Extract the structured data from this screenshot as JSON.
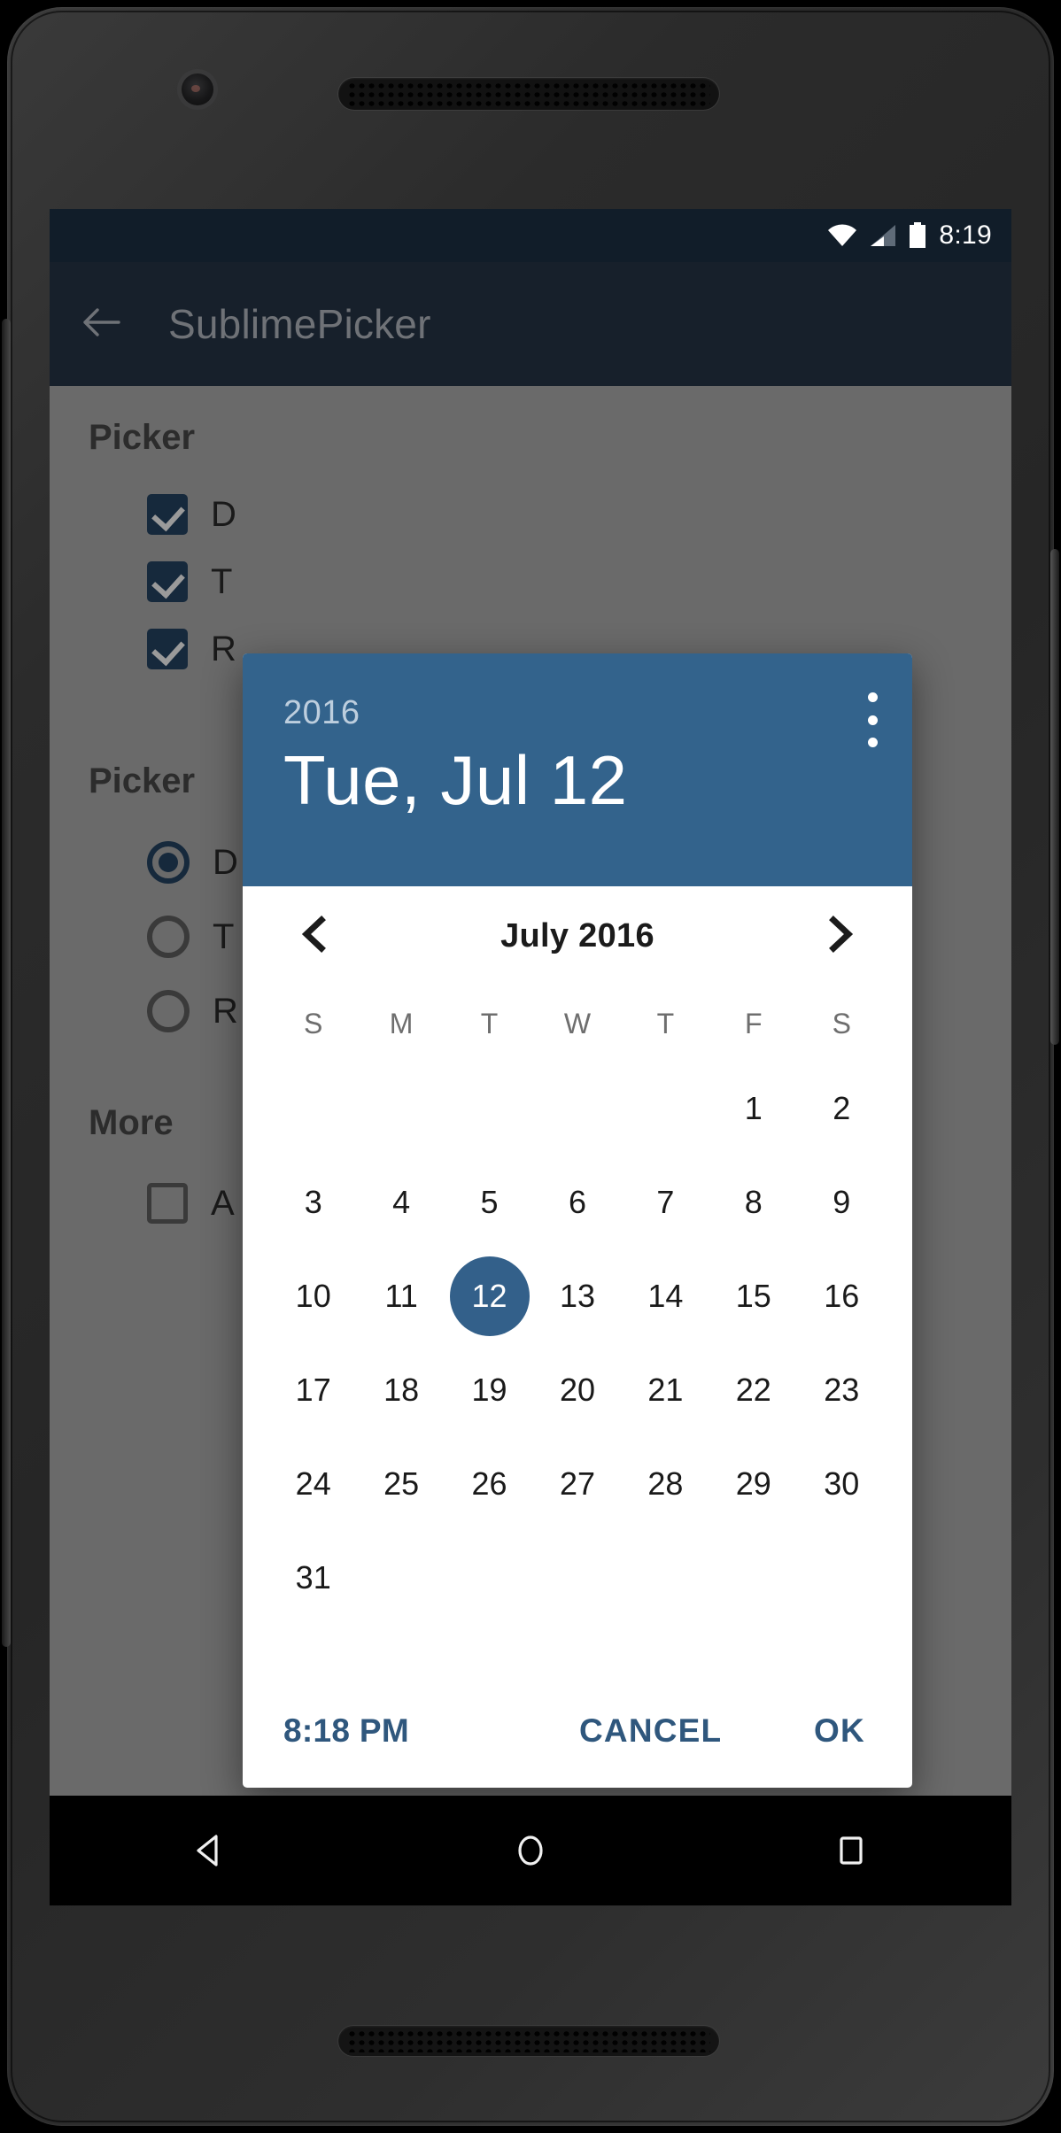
{
  "status_bar": {
    "time": "8:19",
    "icons": [
      "wifi-icon",
      "signal-icon",
      "battery-icon"
    ]
  },
  "app_bar": {
    "back_icon": "back-arrow-icon",
    "title": "SublimePicker"
  },
  "background": {
    "sections": [
      {
        "heading": "Picker",
        "type": "checkbox",
        "options": [
          {
            "label": "D",
            "checked": true
          },
          {
            "label": "T",
            "checked": true
          },
          {
            "label": "R",
            "checked": true
          }
        ]
      },
      {
        "heading": "Picker",
        "type": "radio",
        "options": [
          {
            "label": "D",
            "selected": true
          },
          {
            "label": "T",
            "selected": false
          },
          {
            "label": "R",
            "selected": false
          }
        ]
      },
      {
        "heading": "More",
        "type": "checkbox",
        "options": [
          {
            "label": "A",
            "checked": false
          }
        ]
      }
    ],
    "fab_icon": "rocket-icon"
  },
  "dialog": {
    "header": {
      "year": "2016",
      "date": "Tue, Jul 12",
      "overflow_icon": "overflow-menu-icon"
    },
    "month_nav": {
      "prev_icon": "chevron-left-icon",
      "month_label": "July 2016",
      "next_icon": "chevron-right-icon"
    },
    "weekdays": [
      "S",
      "M",
      "T",
      "W",
      "T",
      "F",
      "S"
    ],
    "weeks": [
      [
        "",
        "",
        "",
        "",
        "",
        "1",
        "2"
      ],
      [
        "3",
        "4",
        "5",
        "6",
        "7",
        "8",
        "9"
      ],
      [
        "10",
        "11",
        "12",
        "13",
        "14",
        "15",
        "16"
      ],
      [
        "17",
        "18",
        "19",
        "20",
        "21",
        "22",
        "23"
      ],
      [
        "24",
        "25",
        "26",
        "27",
        "28",
        "29",
        "30"
      ],
      [
        "31",
        "",
        "",
        "",
        "",
        "",
        ""
      ]
    ],
    "selected_day": "12",
    "actions": {
      "time": "8:18 PM",
      "cancel": "CANCEL",
      "ok": "OK"
    }
  },
  "nav_bar": {
    "back_icon": "nav-back-triangle-icon",
    "home_icon": "nav-home-circle-icon",
    "recents_icon": "nav-recents-square-icon"
  },
  "colors": {
    "accent_blue": "#33638c",
    "selected_day_blue": "#33608a",
    "action_text_blue": "#2f577d",
    "status_bar": "#111d29",
    "app_bar": "#17202b",
    "scrim": "#6a6a6a"
  }
}
